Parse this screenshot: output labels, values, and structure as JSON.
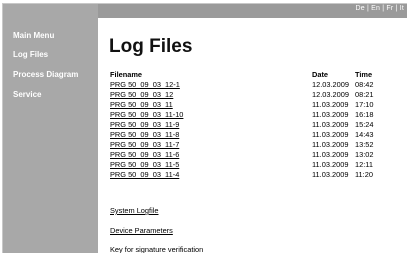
{
  "header": {
    "languages": "De | En | Fr | It"
  },
  "sidebar": {
    "items": [
      {
        "label": "Main Menu"
      },
      {
        "label": "Log Files"
      },
      {
        "label": "Process Diagram"
      },
      {
        "label": "Service"
      }
    ]
  },
  "main": {
    "title": "Log Files",
    "table": {
      "columns": [
        "Filename",
        "Date",
        "Time"
      ],
      "rows": [
        {
          "filename": "PRG 50_09_03_12-1",
          "date": "12.03.2009",
          "time": "08:42"
        },
        {
          "filename": "PRG 50_09_03_12",
          "date": "12.03.2009",
          "time": "08:21"
        },
        {
          "filename": "PRG 50_09_03_11",
          "date": "11.03.2009",
          "time": "17:10"
        },
        {
          "filename": "PRG 50_09_03_11-10",
          "date": "11.03.2009",
          "time": "16:18"
        },
        {
          "filename": "PRG 50_09_03_11-9",
          "date": "11.03.2009",
          "time": "15:24"
        },
        {
          "filename": "PRG 50_09_03_11-8",
          "date": "11.03.2009",
          "time": "14:43"
        },
        {
          "filename": "PRG 50_09_03_11-7",
          "date": "11.03.2009",
          "time": "13:52"
        },
        {
          "filename": "PRG 50_09_03_11-6",
          "date": "11.03.2009",
          "time": "13:02"
        },
        {
          "filename": "PRG 50_09_03_11-5",
          "date": "11.03.2009",
          "time": "12:11"
        },
        {
          "filename": "PRG 50_09_03_11-4",
          "date": "11.03.2009",
          "time": "11:20"
        }
      ]
    },
    "system_logfile": "System Logfile",
    "device_parameters": "Device Parameters",
    "key_text": "Key for signature verification"
  }
}
